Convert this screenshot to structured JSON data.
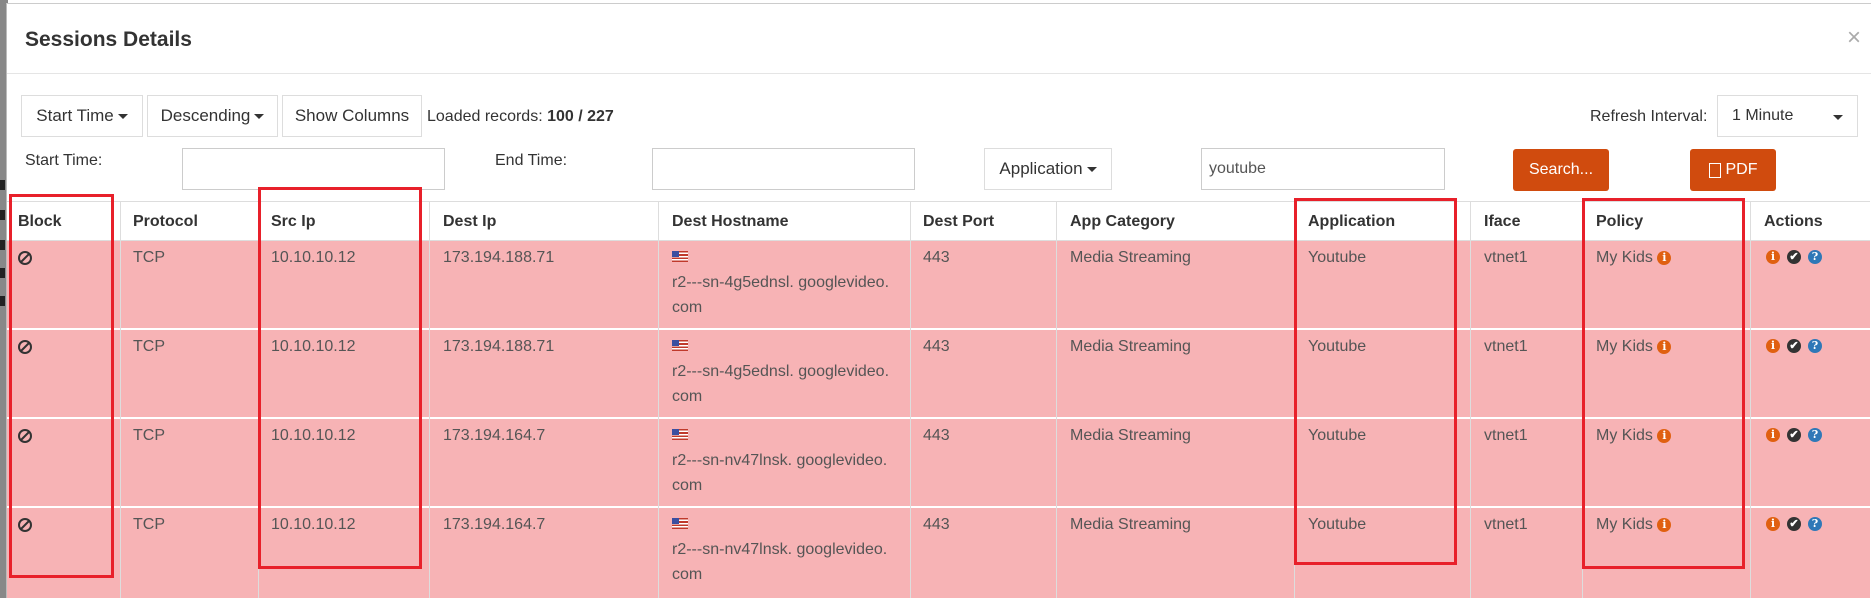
{
  "modal": {
    "title": "Sessions Details",
    "close_glyph": "×"
  },
  "toolbar": {
    "sort_field": "Start Time",
    "sort_order": "Descending",
    "show_columns": "Show Columns",
    "loaded_label": "Loaded records:",
    "loaded_count": "100 / 227",
    "refresh_label": "Refresh Interval:",
    "refresh_value": "1 Minute"
  },
  "filters": {
    "start_time_label": "Start Time:",
    "start_time_value": "",
    "end_time_label": "End Time:",
    "end_time_value": "",
    "filter_field": "Application",
    "search_value": "youtube",
    "search_button": "Search...",
    "pdf_button": "PDF"
  },
  "table": {
    "headers": [
      "Block",
      "Protocol",
      "Src Ip",
      "Dest Ip",
      "Dest Hostname",
      "Dest Port",
      "App Category",
      "Application",
      "Iface",
      "Policy",
      "Actions"
    ],
    "rows": [
      {
        "protocol": "TCP",
        "src_ip": "10.10.10.12",
        "dest_ip": "173.194.188.71",
        "host_line1": "r2---sn-4g5ednsl. googlevideo.",
        "host_line2": "com",
        "dest_port": "443",
        "app_category": "Media Streaming",
        "application": "Youtube",
        "iface": "vtnet1",
        "policy": "My Kids"
      },
      {
        "protocol": "TCP",
        "src_ip": "10.10.10.12",
        "dest_ip": "173.194.188.71",
        "host_line1": "r2---sn-4g5ednsl. googlevideo.",
        "host_line2": "com",
        "dest_port": "443",
        "app_category": "Media Streaming",
        "application": "Youtube",
        "iface": "vtnet1",
        "policy": "My Kids"
      },
      {
        "protocol": "TCP",
        "src_ip": "10.10.10.12",
        "dest_ip": "173.194.164.7",
        "host_line1": "r2---sn-nv47lnsk. googlevideo.",
        "host_line2": "com",
        "dest_port": "443",
        "app_category": "Media Streaming",
        "application": "Youtube",
        "iface": "vtnet1",
        "policy": "My Kids"
      },
      {
        "protocol": "TCP",
        "src_ip": "10.10.10.12",
        "dest_ip": "173.194.164.7",
        "host_line1": "r2---sn-nv47lnsk. googlevideo.",
        "host_line2": "com",
        "dest_port": "443",
        "app_category": "Media Streaming",
        "application": "Youtube",
        "iface": "vtnet1",
        "policy": "My Kids"
      }
    ]
  },
  "icons": {
    "info_glyph": "i",
    "check_glyph": "✔",
    "question_glyph": "?"
  },
  "colors": {
    "row_bg": "#f7b3b5",
    "accent_orange": "#d04b0e",
    "highlight_red": "#e8202a",
    "info_orange": "#e06010",
    "help_blue": "#2f78b7"
  }
}
